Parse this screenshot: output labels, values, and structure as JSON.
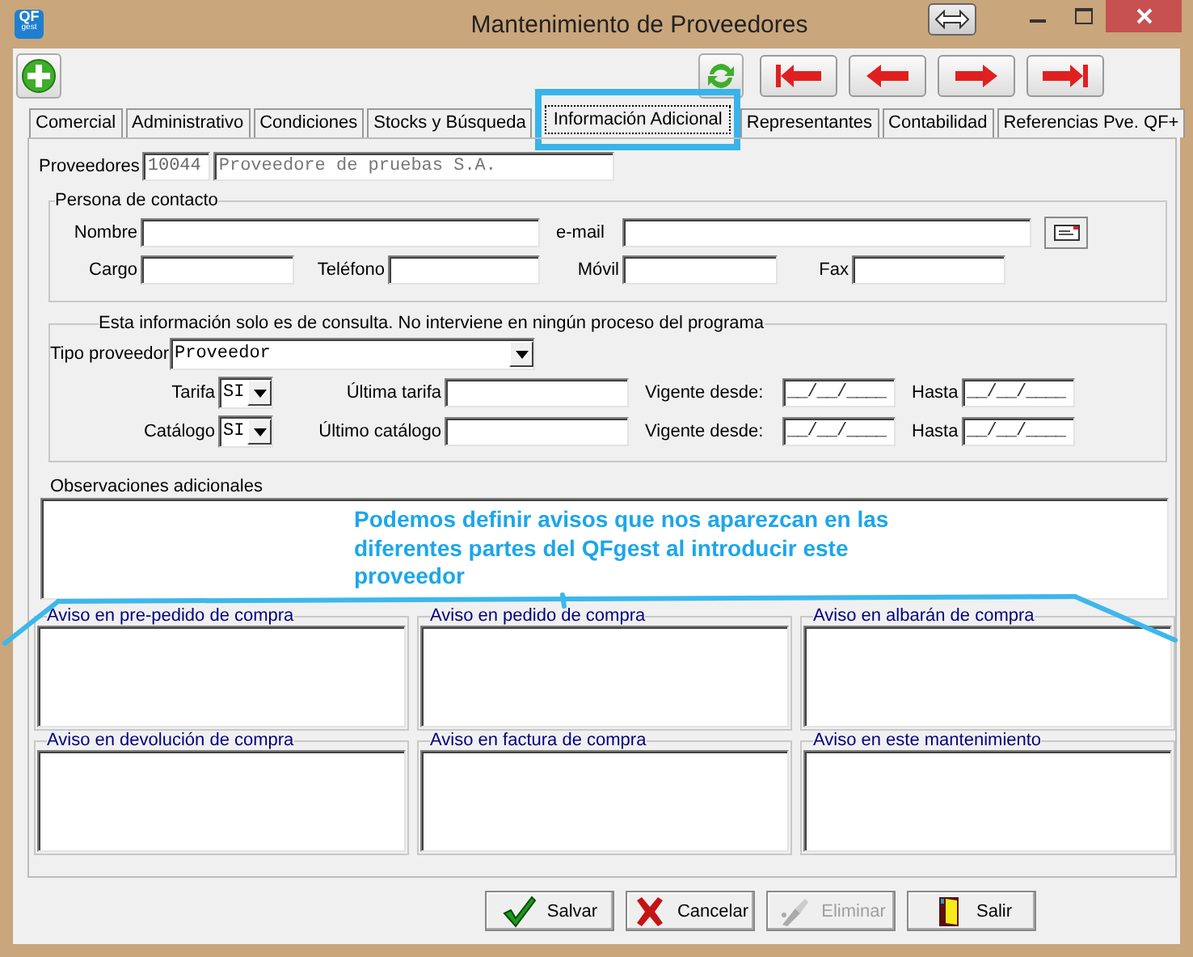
{
  "window": {
    "title": "Mantenimiento de Proveedores",
    "logo": "QF",
    "logo_sub": "gest"
  },
  "tabs": [
    {
      "label": "Comercial",
      "selected": false
    },
    {
      "label": "Administrativo",
      "selected": false
    },
    {
      "label": "Condiciones",
      "selected": false
    },
    {
      "label": "Stocks y Búsqueda",
      "selected": false
    },
    {
      "label": "Información Adicional",
      "selected": true
    },
    {
      "label": "Representantes",
      "selected": false
    },
    {
      "label": "Contabilidad",
      "selected": false
    },
    {
      "label": "Referencias Pve. QF+",
      "selected": false
    }
  ],
  "proveedor": {
    "label": "Proveedores",
    "code": "10044",
    "name": "Proveedore de pruebas S.A."
  },
  "contacto": {
    "legend": "Persona de contacto",
    "fields": [
      {
        "label": "Nombre"
      },
      {
        "label": "e-mail"
      },
      {
        "label": "Cargo"
      },
      {
        "label": "Teléfono"
      },
      {
        "label": "Móvil"
      },
      {
        "label": "Fax"
      }
    ]
  },
  "info": {
    "legend": "Esta información solo es de consulta. No interviene en ningún proceso del programa",
    "tipo_label": "Tipo proveedor",
    "tipo_value": "Proveedor",
    "rows": [
      {
        "label": "Tarifa",
        "value": "SI",
        "last_label": "Última tarifa",
        "from_label": "Vigente desde:",
        "from_value": "__/__/____",
        "to_label": "Hasta",
        "to_value": "__/__/____"
      },
      {
        "label": "Catálogo",
        "value": "SI",
        "last_label": "Último catálogo",
        "from_label": "Vigente desde:",
        "from_value": "__/__/____",
        "to_label": "Hasta",
        "to_value": "__/__/____"
      }
    ]
  },
  "observaciones": {
    "label": "Observaciones adicionales"
  },
  "avisos": [
    {
      "label": "Aviso en pre-pedido de compra"
    },
    {
      "label": "Aviso en pedido de compra"
    },
    {
      "label": "Aviso en albarán de compra"
    },
    {
      "label": "Aviso en devolución de compra"
    },
    {
      "label": "Aviso en factura de compra"
    },
    {
      "label": "Aviso en este mantenimiento"
    }
  ],
  "buttons": [
    {
      "label": "Salvar",
      "kind": "save",
      "disabled": false
    },
    {
      "label": "Cancelar",
      "kind": "cancel",
      "disabled": false
    },
    {
      "label": "Eliminar",
      "kind": "delete",
      "disabled": true
    },
    {
      "label": "Salir",
      "kind": "exit",
      "disabled": false
    }
  ],
  "annotation": {
    "text": "Podemos definir avisos que nos aparezcan en las diferentes partes del QFgest al introducir este proveedor"
  }
}
